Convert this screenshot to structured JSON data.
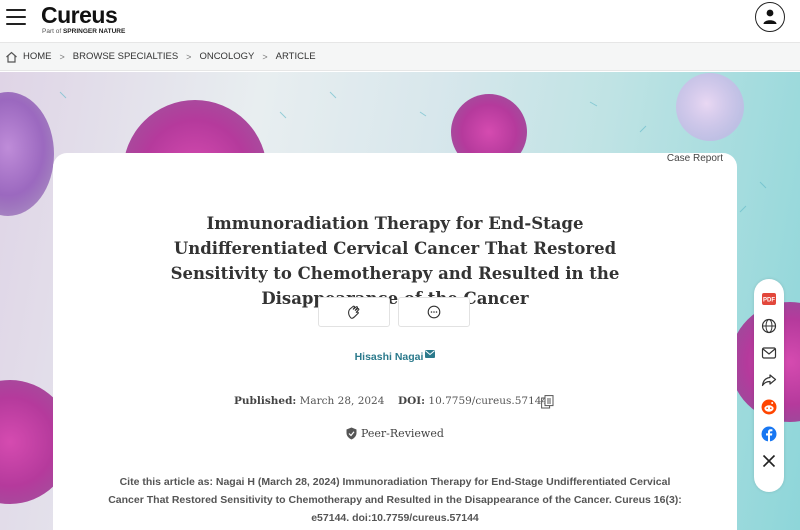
{
  "header": {
    "logo_text": "Cureus",
    "logo_sub_prefix": "Part of",
    "logo_sub_brand": "SPRINGER NATURE"
  },
  "breadcrumb": [
    "HOME",
    "BROWSE SPECIALTIES",
    "ONCOLOGY",
    "ARTICLE"
  ],
  "article": {
    "type_label": "Case Report",
    "title": "Immunoradiation Therapy for End-Stage Undifferentiated Cervical Cancer That Restored Sensitivity to Chemotherapy and Resulted in the Disappearance of the Cancer",
    "author": "Hisashi Nagai",
    "published_label": "Published:",
    "published_date": "March 28, 2024",
    "doi_label": "DOI:",
    "doi_value": "10.7759/cureus.57144",
    "peer_reviewed": "Peer-Reviewed",
    "citation": "Cite this article as: Nagai H (March 28, 2024) Immunoradiation Therapy for End-Stage Undifferentiated Cervical Cancer That Restored Sensitivity to Chemotherapy and Resulted in the Disappearance of the Cancer. Cureus 16(3): e57144. doi:10.7759/cureus.57144"
  },
  "share_rail": {
    "items": [
      "pdf-icon",
      "globe-icon",
      "email-icon",
      "share-icon",
      "reddit-icon",
      "facebook-icon",
      "x-icon"
    ],
    "pdf_label": "PDF"
  },
  "colors": {
    "author_link": "#2b7a8c",
    "pdf_red": "#e2473b",
    "reddit_orange": "#ff4500",
    "facebook_blue": "#1877f2"
  }
}
